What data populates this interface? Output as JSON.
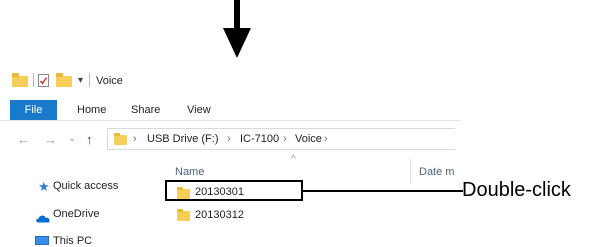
{
  "titlebar": {
    "title": "Voice",
    "quick_access_toolbar": [
      "folder-icon",
      "properties-check-icon",
      "new-folder-icon",
      "customize-dropdown-icon"
    ]
  },
  "ribbon": {
    "tabs": [
      {
        "label": "File",
        "active": true
      },
      {
        "label": "Home"
      },
      {
        "label": "Share"
      },
      {
        "label": "View"
      }
    ],
    "file_tab_color": "#1979CA"
  },
  "address_bar": {
    "breadcrumb": [
      "USB Drive (F:)",
      "IC-7100",
      "Voice"
    ],
    "separator": ">"
  },
  "navigation_pane": {
    "items": [
      {
        "label": "Quick access",
        "icon": "star-icon",
        "color": "#2e7cd6"
      },
      {
        "label": "OneDrive",
        "icon": "cloud-icon",
        "color": "#0a6ed1"
      },
      {
        "label": "This PC",
        "icon": "monitor-icon",
        "color": "#3a8ee6"
      }
    ]
  },
  "file_list": {
    "columns": [
      "Name",
      "Date m"
    ],
    "rows": [
      {
        "name": "20130301",
        "highlighted": true
      },
      {
        "name": "20130312"
      }
    ]
  },
  "annotation": {
    "callout": "Double-click",
    "arrow": "down-arrow-icon"
  }
}
